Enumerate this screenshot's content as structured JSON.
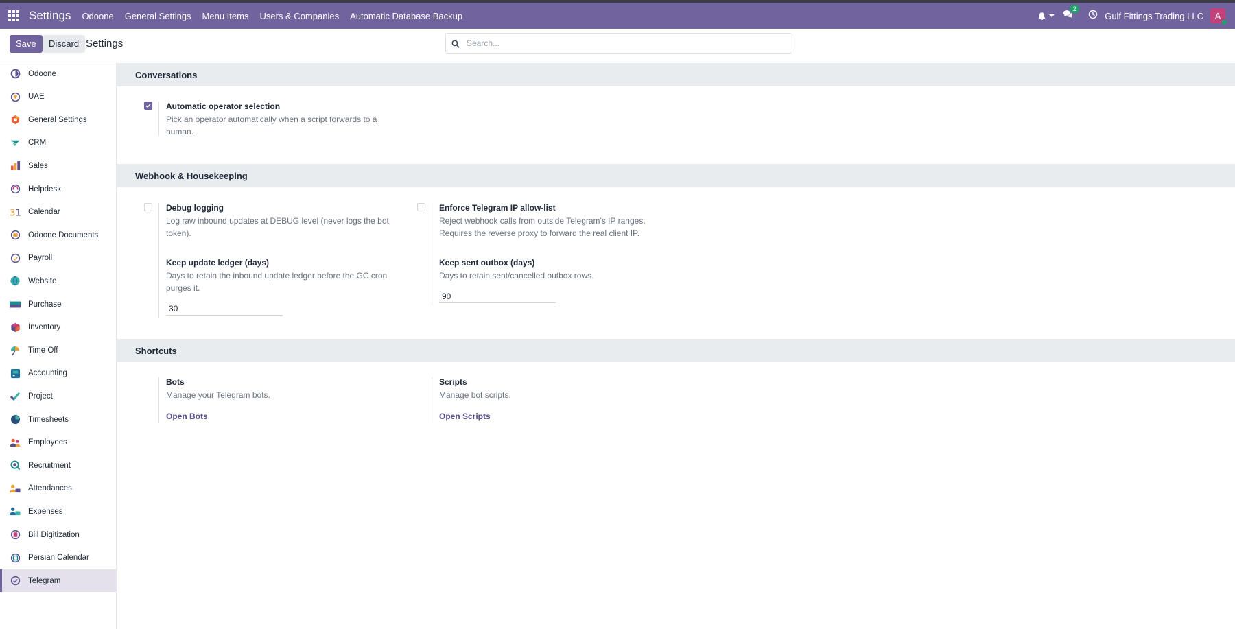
{
  "navbar": {
    "brand": "Settings",
    "menu": [
      "Odoone",
      "General Settings",
      "Menu Items",
      "Users & Companies",
      "Automatic Database Backup"
    ],
    "chat_count": "2",
    "company": "Gulf Fittings Trading LLC",
    "avatar_letter": "A",
    "bg_color": "#71639e"
  },
  "control": {
    "save_label": "Save",
    "discard_label": "Discard",
    "title": "Settings",
    "search_placeholder": "Search..."
  },
  "sidebar": {
    "active": "Telegram",
    "items": [
      {
        "label": "Odoone",
        "icon": "odoone-icon"
      },
      {
        "label": "UAE",
        "icon": "pin-icon"
      },
      {
        "label": "General Settings",
        "icon": "settings-icon"
      },
      {
        "label": "CRM",
        "icon": "crm-icon"
      },
      {
        "label": "Sales",
        "icon": "sales-icon"
      },
      {
        "label": "Helpdesk",
        "icon": "helpdesk-icon"
      },
      {
        "label": "Calendar",
        "icon": "calendar-icon"
      },
      {
        "label": "Odoone Documents",
        "icon": "documents-icon"
      },
      {
        "label": "Payroll",
        "icon": "payroll-icon"
      },
      {
        "label": "Website",
        "icon": "website-icon"
      },
      {
        "label": "Purchase",
        "icon": "purchase-icon"
      },
      {
        "label": "Inventory",
        "icon": "inventory-icon"
      },
      {
        "label": "Time Off",
        "icon": "time-off-icon"
      },
      {
        "label": "Accounting",
        "icon": "accounting-icon"
      },
      {
        "label": "Project",
        "icon": "project-icon"
      },
      {
        "label": "Timesheets",
        "icon": "timesheets-icon"
      },
      {
        "label": "Employees",
        "icon": "employees-icon"
      },
      {
        "label": "Recruitment",
        "icon": "recruitment-icon"
      },
      {
        "label": "Attendances",
        "icon": "attendances-icon"
      },
      {
        "label": "Expenses",
        "icon": "expenses-icon"
      },
      {
        "label": "Bill Digitization",
        "icon": "bill-digitization-icon"
      },
      {
        "label": "Persian Calendar",
        "icon": "persian-calendar-icon"
      },
      {
        "label": "Telegram",
        "icon": "telegram-icon"
      }
    ]
  },
  "sections": {
    "conversations": {
      "title": "Conversations",
      "auto_operator": {
        "title": "Automatic operator selection",
        "desc": "Pick an operator automatically when a script forwards to a human.",
        "checked": true
      }
    },
    "webhook": {
      "title": "Webhook & Housekeeping",
      "debug": {
        "title": "Debug logging",
        "desc": "Log raw inbound updates at DEBUG level (never logs the bot token).",
        "checked": false
      },
      "ip_allow": {
        "title": "Enforce Telegram IP allow-list",
        "desc": "Reject webhook calls from outside Telegram's IP ranges. Requires the reverse proxy to forward the real client IP.",
        "checked": false
      },
      "ledger": {
        "title": "Keep update ledger (days)",
        "desc": "Days to retain the inbound update ledger before the GC cron purges it.",
        "value": "30"
      },
      "outbox": {
        "title": "Keep sent outbox (days)",
        "desc": "Days to retain sent/cancelled outbox rows.",
        "value": "90"
      }
    },
    "shortcuts": {
      "title": "Shortcuts",
      "bots": {
        "title": "Bots",
        "desc": "Manage your Telegram bots.",
        "link": "Open Bots"
      },
      "scripts": {
        "title": "Scripts",
        "desc": "Manage bot scripts.",
        "link": "Open Scripts"
      }
    }
  }
}
